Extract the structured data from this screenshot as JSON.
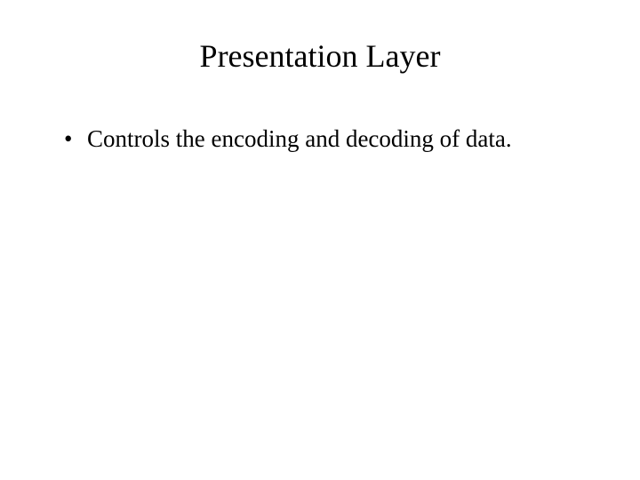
{
  "slide": {
    "title": "Presentation Layer",
    "bullets": [
      "Controls the encoding and decoding of data."
    ]
  }
}
